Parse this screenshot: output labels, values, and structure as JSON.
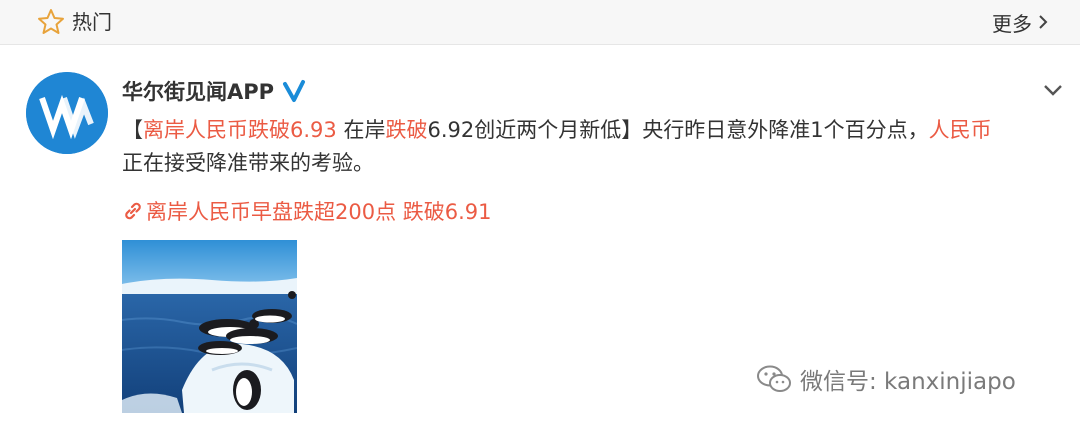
{
  "header": {
    "title": "热门",
    "more_label": "更多"
  },
  "post": {
    "username": "华尔街见闻APP",
    "verified": true,
    "text_segments": {
      "s1": "【",
      "s2": "离岸人民币跌破6.93",
      "s3": " 在岸",
      "s4": "跌破",
      "s5": "6.92创近两个月新低】央行昨日意外降准1个百分点，",
      "s6": "人民币",
      "s7": "正在接受降准带来的考验。"
    },
    "link_text": "离岸人民币早盘跌超200点 跌破6.91",
    "image_icon": "penguins-on-ice-photo"
  },
  "watermark": {
    "text": "微信号: kanxinjiapo"
  },
  "colors": {
    "accent_red": "#eb5b44",
    "verified_blue": "#1a8cd8",
    "avatar_blue": "#1f86d4",
    "text": "#333333"
  }
}
